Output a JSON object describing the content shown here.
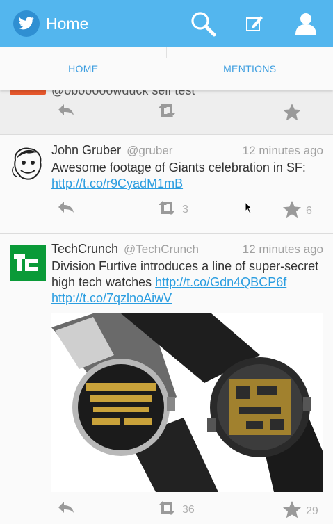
{
  "header": {
    "title": "Home",
    "brand_color": "#53b6ee",
    "icons": [
      "twitter-bird-icon",
      "search-icon",
      "compose-icon",
      "profile-icon"
    ]
  },
  "tabs": [
    {
      "label": "HOME"
    },
    {
      "label": "MENTIONS"
    }
  ],
  "partial_tweet": {
    "text": "@obooooowduck self test"
  },
  "tweets": [
    {
      "name": "John Gruber",
      "handle": "@gruber",
      "time": "12 minutes ago",
      "text": "Awesome footage of Giants celebration in SF:",
      "link": "http://t.co/r9CyadM1mB",
      "retweets": "3",
      "favorites": "6"
    },
    {
      "name": "TechCrunch",
      "handle": "@TechCrunch",
      "time": "12 minutes ago",
      "text": "Division Furtive introduces a line of super-secret high tech watches",
      "link1": "http://t.co/Gdn4QBCP6f",
      "link2": "http://t.co/7qzlnoAiwV",
      "logo_text": "TC",
      "retweets": "36",
      "favorites": "29"
    }
  ],
  "colors": {
    "link": "#2a9de0",
    "tab_text": "#3d9ee0",
    "techcrunch_green": "#0a9a38",
    "action_icon": "#9a9a9a"
  }
}
